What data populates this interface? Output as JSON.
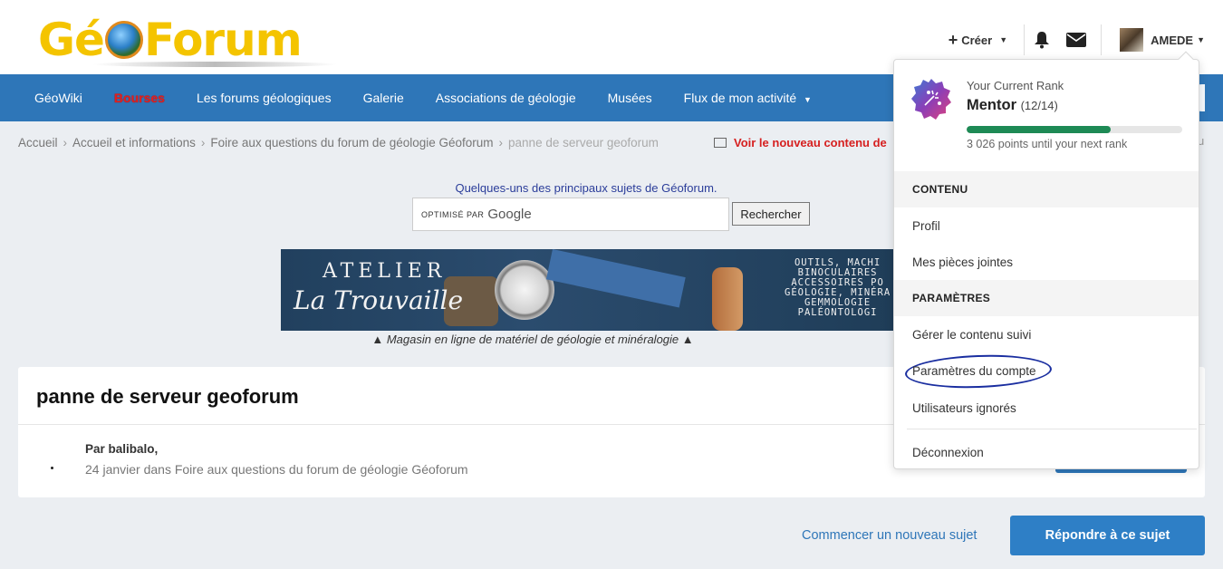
{
  "logo": {
    "text_left": "Gé",
    "text_right": "Forum"
  },
  "header": {
    "create_label": "Créer",
    "username": "AMEDE"
  },
  "nav": {
    "items": [
      "GéoWiki",
      "Bourses",
      "Les forums géologiques",
      "Galerie",
      "Associations de géologie",
      "Musées",
      "Flux de mon activité"
    ]
  },
  "breadcrumb": {
    "items": [
      "Accueil",
      "Accueil et informations",
      "Foire aux questions du forum de géologie Géoforum",
      "panne de serveur geoforum"
    ],
    "new_content": "Voir le nouveau contenu de",
    "edge_text": "u"
  },
  "search": {
    "title": "Quelques-uns des principaux sujets de Géoforum.",
    "optimise": "OPTIMISÉ PAR",
    "google": "Google",
    "button": "Rechercher"
  },
  "banner": {
    "atelier": "ATELIER",
    "trouvaille": "La Trouvaille",
    "list": [
      "OUTILS, MACHI",
      "BINOCULAIRES",
      "ACCESSOIRES PO",
      "GÉOLOGIE, MINÉRA",
      "GEMMOLOGIE",
      "PALÉONTOLOGI"
    ],
    "caption": "▲  Magasin en ligne de matériel de géologie et minéralogie  ▲"
  },
  "topic": {
    "title": "panne de serveur geoforum",
    "author": "Par balibalo,",
    "meta": "24 janvier dans Foire aux questions du forum de géologie Géoforum"
  },
  "actions": {
    "new_topic": "Commencer un nouveau sujet",
    "reply": "Répondre à ce sujet"
  },
  "menu": {
    "rank_label": "Your Current Rank",
    "rank_name": "Mentor",
    "rank_fraction": "(12/14)",
    "progress": 0.67,
    "points": "3 026 points until your next rank",
    "section_content": "CONTENU",
    "profil": "Profil",
    "attachments": "Mes pièces jointes",
    "section_settings": "PARAMÈTRES",
    "followed": "Gérer le contenu suivi",
    "account_settings": "Paramètres du compte",
    "ignored": "Utilisateurs ignorés",
    "logout": "Déconnexion"
  },
  "colors": {
    "nav_bg": "#2e76b8",
    "logo_yellow": "#f4c400",
    "bourses_red": "#e0201e",
    "rank_progress": "#1e8a55",
    "annotation_circle": "#1a2ea0"
  }
}
